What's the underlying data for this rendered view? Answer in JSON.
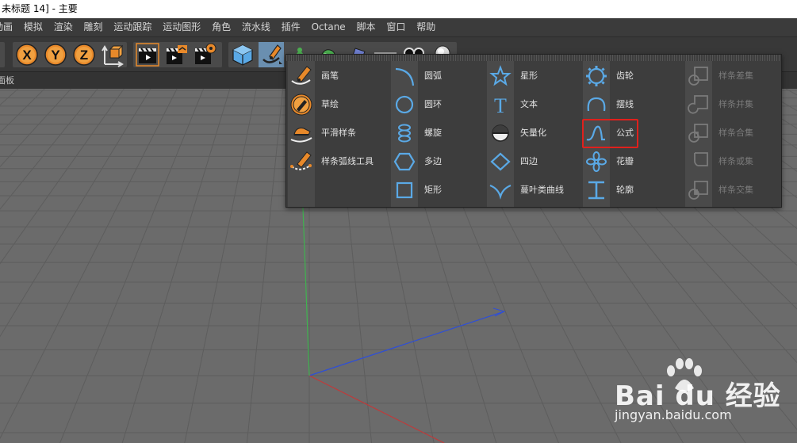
{
  "window": {
    "title": "未标题 14] - 主要"
  },
  "menu": [
    "动画",
    "模拟",
    "渲染",
    "雕刻",
    "运动跟踪",
    "运动图形",
    "角色",
    "流水线",
    "插件",
    "Octane",
    "脚本",
    "窗口",
    "帮助"
  ],
  "toolbar": {
    "icons": [
      "x-axis-icon",
      "y-axis-icon",
      "z-axis-icon",
      "coordinate-system-icon",
      "render-view-icon",
      "render-to-picture-viewer-icon",
      "render-settings-icon",
      "cube-icon",
      "pen-icon",
      "cogwheel-icon",
      "subdivision-icon",
      "deformer-icon",
      "floor-icon",
      "camera-icon",
      "light-icon"
    ]
  },
  "subbar": {
    "label": "面板"
  },
  "palette": {
    "columns": [
      {
        "items": [
          {
            "label": "画笔",
            "icon": "pen-icon",
            "enabled": true
          },
          {
            "label": "草绘",
            "icon": "sketch-icon",
            "enabled": true
          },
          {
            "label": "平滑样条",
            "icon": "smooth-spline-icon",
            "enabled": true
          },
          {
            "label": "样条弧线工具",
            "icon": "spline-arc-tool-icon",
            "enabled": true
          }
        ]
      },
      {
        "items": [
          {
            "label": "圆弧",
            "icon": "arc-icon",
            "enabled": true
          },
          {
            "label": "圆环",
            "icon": "circle-icon",
            "enabled": true
          },
          {
            "label": "螺旋",
            "icon": "helix-icon",
            "enabled": true
          },
          {
            "label": "多边",
            "icon": "polygon-icon",
            "enabled": true
          },
          {
            "label": "矩形",
            "icon": "rectangle-icon",
            "enabled": true
          }
        ]
      },
      {
        "items": [
          {
            "label": "星形",
            "icon": "star-icon",
            "enabled": true
          },
          {
            "label": "文本",
            "icon": "text-icon",
            "enabled": true
          },
          {
            "label": "矢量化",
            "icon": "vectorizer-icon",
            "enabled": true
          },
          {
            "label": "四边",
            "icon": "four-side-icon",
            "enabled": true
          },
          {
            "label": "蔓叶类曲线",
            "icon": "cissoid-icon",
            "enabled": true
          }
        ]
      },
      {
        "items": [
          {
            "label": "齿轮",
            "icon": "cog-icon",
            "enabled": true
          },
          {
            "label": "摆线",
            "icon": "cycloid-icon",
            "enabled": true
          },
          {
            "label": "公式",
            "icon": "formula-icon",
            "enabled": true,
            "highlighted": true
          },
          {
            "label": "花瓣",
            "icon": "flower-icon",
            "enabled": true
          },
          {
            "label": "轮廓",
            "icon": "profile-icon",
            "enabled": true
          }
        ]
      },
      {
        "items": [
          {
            "label": "样条差集",
            "icon": "spline-subtract-icon",
            "enabled": false
          },
          {
            "label": "样条并集",
            "icon": "spline-union-icon",
            "enabled": false
          },
          {
            "label": "样条合集",
            "icon": "spline-and-icon",
            "enabled": false
          },
          {
            "label": "样条或集",
            "icon": "spline-or-icon",
            "enabled": false
          },
          {
            "label": "样条交集",
            "icon": "spline-intersect-icon",
            "enabled": false
          }
        ]
      }
    ]
  },
  "watermark": {
    "brand": "Bai du 经验",
    "url": "jingyan.baidu.com"
  },
  "colors": {
    "accent_blue": "#5aa9e6",
    "accent_orange": "#e8892a",
    "highlight": "#e0201c",
    "viewport": "#6b6b6b"
  }
}
